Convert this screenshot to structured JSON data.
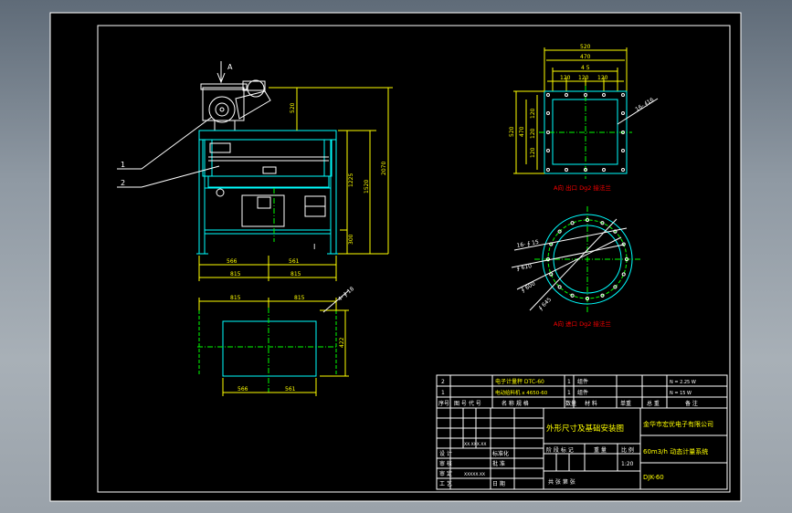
{
  "colors": {
    "background": "#8e959d",
    "sheet": "#000000",
    "frame": "#ffffff",
    "dimension": "#ffff00",
    "outline": "#00ffff",
    "centerline": "#00ff00",
    "section_text": "#ff0000",
    "leader": "#ffffff",
    "magenta": "#ff00ff"
  },
  "front_view": {
    "arrow_label": "A",
    "balloon_1": "1",
    "balloon_2": "2",
    "dim_top": "520",
    "dim_mid": "1225",
    "dim_overall": "2070",
    "dim_inner": "1520",
    "dim_bottom": "300",
    "dim_left_half": "566",
    "dim_right_half": "561",
    "dim_span_left": "815",
    "dim_span_right": "815",
    "section_mark": "I"
  },
  "top_flange_view": {
    "dim_outer_width": "520",
    "dim_inner_width": "470",
    "dim_bolt_spacing": "4 5",
    "dim_pitch_1": "120",
    "dim_pitch_2": "120",
    "dim_pitch_3": "120",
    "dim_side_outer": "520",
    "dim_side_inner": "470",
    "dim_side_p1": "120",
    "dim_side_p2": "120",
    "dim_side_p3": "120",
    "hole_note": "16- ∮16",
    "caption": "A向 出口 Dg2 接法兰"
  },
  "round_flange_view": {
    "hole_note": "16- ∮ 15",
    "dim_a": "∮ 610",
    "dim_b": "∮ 600",
    "dim_c": "∮ 645",
    "caption": "A向 进口 Dg2 接法兰"
  },
  "foundation_view": {
    "dim_left_top": "815",
    "dim_right_top": "815",
    "dim_height": "422",
    "dim_left_bottom": "566",
    "dim_right_bottom": "561",
    "hole_note": "4- ∮ 18"
  },
  "parts_list": [
    {
      "no": "2",
      "name": "电子计量秤 DTC-60",
      "qty": "1",
      "material": "组件",
      "note": "N = 2.25 W"
    },
    {
      "no": "1",
      "name": "电动给料机 x 4650-60",
      "qty": "1",
      "material": "组件",
      "note": "N = 15 W"
    }
  ],
  "parts_header": {
    "no": "序号",
    "code": "图 号 代 号",
    "name": "名 称 规 格",
    "qty": "数量",
    "material": "材 料",
    "unit_weight": "单重",
    "total_weight": "总 重",
    "note": "备 注"
  },
  "title_block": {
    "drawing_title": "外形尺寸及基础安装图",
    "company": "金华市宏优电子有限公司",
    "project": "60m3/h 动态计量系统",
    "drawing_no": "DJK-60",
    "stage_label": "阶 段 标 记",
    "weight_label": "重 量",
    "scale_label": "比 例",
    "scale_value": "1:20",
    "sheet_label": "共   张   第   张",
    "design_label": "设 计",
    "check_label": "审 核",
    "approve_label": "审 定",
    "process_label": "工 艺",
    "standard_label": "标准化",
    "date_label": "日 期",
    "approval_label": "批 准",
    "design_name": "XX.XXX.XX",
    "check_name": "XXXXX.XX"
  }
}
